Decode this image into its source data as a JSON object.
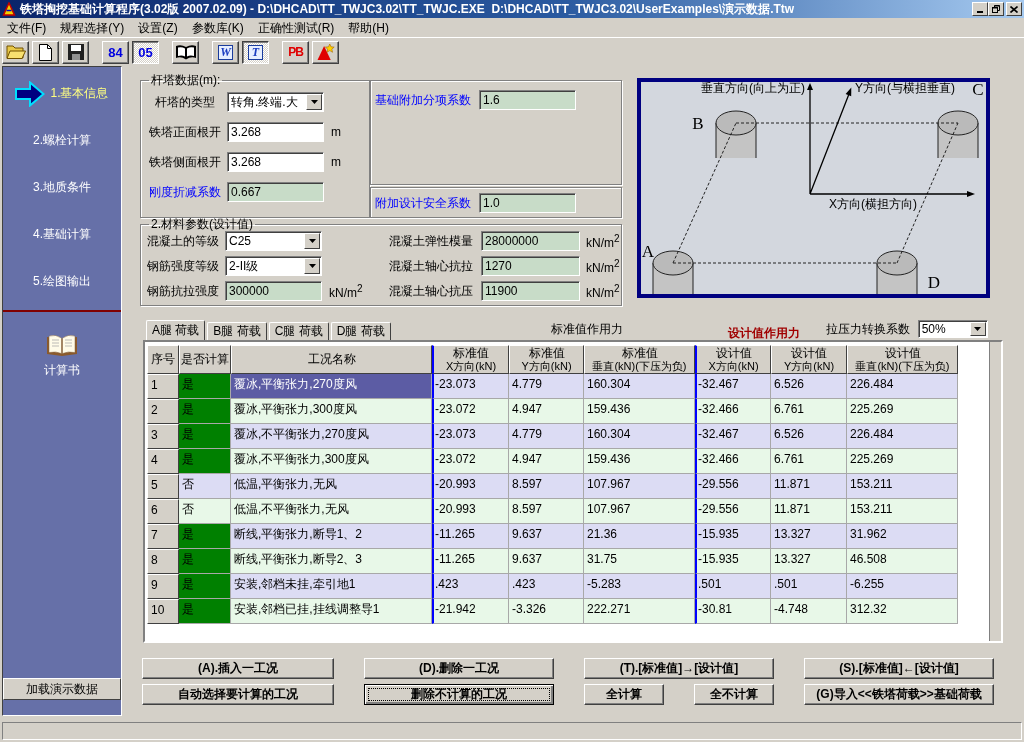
{
  "window": {
    "title": "铁塔掏挖基础计算程序(3.02版 2007.02.09) - D:\\DHCAD\\TT_TWJC3.02\\TT_TWJC.EXE  D:\\DHCAD\\TT_TWJC3.02\\UserExamples\\演示数据.Ttw"
  },
  "menu": [
    {
      "label": "文件(F)"
    },
    {
      "label": "规程选择(Y)"
    },
    {
      "label": "设置(Z)"
    },
    {
      "label": "参数库(K)"
    },
    {
      "label": "正确性测试(R)"
    },
    {
      "label": "帮助(H)"
    }
  ],
  "toolbar": {
    "groups": [
      {
        "items": [
          {
            "kind": "open",
            "pressed": false
          },
          {
            "kind": "new",
            "pressed": false
          },
          {
            "kind": "save",
            "pressed": false
          }
        ]
      },
      {
        "items": [
          {
            "kind": "text",
            "label": "84",
            "pressed": false
          },
          {
            "kind": "text",
            "label": "05",
            "pressed": true
          }
        ]
      },
      {
        "items": [
          {
            "kind": "manual",
            "pressed": false
          }
        ]
      },
      {
        "items": [
          {
            "kind": "tile",
            "label": "W",
            "pressed": false
          },
          {
            "kind": "tile",
            "label": "T",
            "pressed": true
          }
        ]
      },
      {
        "items": [
          {
            "kind": "pb",
            "label": "PB",
            "pressed": false
          },
          {
            "kind": "tool",
            "pressed": false
          }
        ]
      }
    ]
  },
  "sidebar": {
    "steps": [
      {
        "label": "1.基本信息",
        "selected": true
      },
      {
        "label": "2.螺栓计算",
        "selected": false
      },
      {
        "label": "3.地质条件",
        "selected": false
      },
      {
        "label": "4.基础计算",
        "selected": false
      },
      {
        "label": "5.绘图输出",
        "selected": false
      }
    ],
    "report": {
      "label": "计算书"
    },
    "load_button": {
      "label": "加载演示数据"
    }
  },
  "tower_data": {
    "title": "杆塔数据(m):",
    "fields": [
      {
        "kind": "combo",
        "label": "杆塔的类型",
        "value": "转角.终端.大",
        "emphasized": false
      },
      {
        "kind": "input",
        "label": "铁塔正面根开",
        "value": "3.268",
        "unit": "m",
        "emphasized": false
      },
      {
        "kind": "input",
        "label": "铁塔侧面根开",
        "value": "3.268",
        "unit": "m",
        "emphasized": false
      },
      {
        "kind": "readonly",
        "label": "刚度折减系数",
        "value": "0.667",
        "emphasized": true
      }
    ]
  },
  "factors": [
    {
      "label": "基础附加分项系数",
      "value": "1.6",
      "emphasized": true
    },
    {
      "label": "附加设计安全系数",
      "value": "1.0",
      "emphasized": true
    }
  ],
  "materials": {
    "title": "2.材料参数(设计值)",
    "left": [
      {
        "kind": "combo",
        "label": "混凝土的等级",
        "value": "C25"
      },
      {
        "kind": "combo",
        "label": "钢筋强度等级",
        "value": "2-II级"
      },
      {
        "kind": "readonly",
        "label": "钢筋抗拉强度",
        "value": "300000",
        "unit": "kN/m$^{2}$"
      }
    ],
    "right": [
      {
        "kind": "readonly",
        "label": "混凝土弹性模量",
        "value": "28000000",
        "unit": "kN/m$^{2}$"
      },
      {
        "kind": "readonly",
        "label": "混凝土轴心抗拉",
        "value": "1270",
        "unit": "kN/m$^{2}$"
      },
      {
        "kind": "readonly",
        "label": "混凝土轴心抗压",
        "value": "11900",
        "unit": "kN/m$^{2}$"
      }
    ]
  },
  "diagram": {
    "vertical_axis": "垂直方向(向上为正)",
    "y_axis": "Y方向(与横担垂直)",
    "x_axis": "X方向(横担方向)",
    "legs": [
      {
        "label": "A"
      },
      {
        "label": "B"
      },
      {
        "label": "C"
      },
      {
        "label": "D"
      }
    ]
  },
  "load_tabs": [
    {
      "label": "A腿 荷载",
      "selected": true
    },
    {
      "label": "B腿 荷载",
      "selected": false
    },
    {
      "label": "C腿 荷载",
      "selected": false
    },
    {
      "label": "D腿 荷载",
      "selected": false
    }
  ],
  "force_labels": {
    "standard": "标准值作用力",
    "design": "设计值作用力"
  },
  "ratio": {
    "label": "拉压力转换系数",
    "value": "50%"
  },
  "table": {
    "columns": [
      {
        "kind": "index",
        "title": "序号",
        "divider_before": false
      },
      {
        "kind": "flag",
        "title": "是否计算",
        "divider_before": false
      },
      {
        "kind": "text",
        "title": "工况名称",
        "divider_before": false
      },
      {
        "kind": "number",
        "title": "标准值",
        "subtitle": "X方向(kN)",
        "divider_before": true
      },
      {
        "kind": "number",
        "title": "标准值",
        "subtitle": "Y方向(kN)",
        "divider_before": false
      },
      {
        "kind": "number",
        "title": "标准值",
        "subtitle": "垂直(kN)(下压为负)",
        "divider_before": false
      },
      {
        "kind": "number",
        "title": "设计值",
        "subtitle": "X方向(kN)",
        "divider_before": true
      },
      {
        "kind": "number",
        "title": "设计值",
        "subtitle": "Y方向(kN)",
        "divider_before": false
      },
      {
        "kind": "number",
        "title": "设计值",
        "subtitle": "垂直(kN)(下压为负)",
        "divider_before": false
      }
    ],
    "rows": [
      {
        "cells": [
          "1",
          "是",
          "覆冰,平衡张力,270度风",
          "-23.073",
          "4.779",
          "160.304",
          "-32.467",
          "6.526",
          "226.484"
        ],
        "computed": true,
        "selected": true
      },
      {
        "cells": [
          "2",
          "是",
          "覆冰,平衡张力,300度风",
          "-23.072",
          "4.947",
          "159.436",
          "-32.466",
          "6.761",
          "225.269"
        ],
        "computed": true,
        "selected": false
      },
      {
        "cells": [
          "3",
          "是",
          "覆冰,不平衡张力,270度风",
          "-23.073",
          "4.779",
          "160.304",
          "-32.467",
          "6.526",
          "226.484"
        ],
        "computed": true,
        "selected": false
      },
      {
        "cells": [
          "4",
          "是",
          "覆冰,不平衡张力,300度风",
          "-23.072",
          "4.947",
          "159.436",
          "-32.466",
          "6.761",
          "225.269"
        ],
        "computed": true,
        "selected": false
      },
      {
        "cells": [
          "5",
          "否",
          "低温,平衡张力,无风",
          "-20.993",
          "8.597",
          "107.967",
          "-29.556",
          "11.871",
          "153.211"
        ],
        "computed": false,
        "selected": false
      },
      {
        "cells": [
          "6",
          "否",
          "低温,不平衡张力,无风",
          "-20.993",
          "8.597",
          "107.967",
          "-29.556",
          "11.871",
          "153.211"
        ],
        "computed": false,
        "selected": false
      },
      {
        "cells": [
          "7",
          "是",
          "断线,平衡张力,断导1、2",
          "-11.265",
          "9.637",
          "21.36",
          "-15.935",
          "13.327",
          "31.962"
        ],
        "computed": true,
        "selected": false
      },
      {
        "cells": [
          "8",
          "是",
          "断线,平衡张力,断导2、3",
          "-11.265",
          "9.637",
          "31.75",
          "-15.935",
          "13.327",
          "46.508"
        ],
        "computed": true,
        "selected": false
      },
      {
        "cells": [
          "9",
          "是",
          "安装,邻档未挂,牵引地1",
          ".423",
          ".423",
          "-5.283",
          ".501",
          ".501",
          "-6.255"
        ],
        "computed": true,
        "selected": false
      },
      {
        "cells": [
          "10",
          "是",
          "安装,邻档已挂,挂线调整导1",
          "-21.942",
          "-3.326",
          "222.271",
          "-30.81",
          "-4.748",
          "312.32"
        ],
        "computed": true,
        "selected": false
      }
    ]
  },
  "actions": {
    "rows": [
      {
        "buttons": [
          {
            "label": "(A).插入一工况",
            "focused": false
          },
          {
            "label": "(D).删除一工况",
            "focused": false
          },
          {
            "label": "(T).[标准值]→[设计值]",
            "focused": false
          },
          {
            "label": "(S).[标准值]←[设计值]",
            "focused": false
          }
        ]
      },
      {
        "buttons": [
          {
            "label": "自动选择要计算的工况",
            "focused": false
          },
          {
            "label": "删除不计算的工况",
            "focused": true
          },
          {
            "label": "全计算",
            "focused": false
          },
          {
            "label": "全不计算",
            "focused": false
          },
          {
            "label": "(G)导入<<铁塔荷载>>基础荷载",
            "focused": false
          }
        ]
      }
    ]
  }
}
